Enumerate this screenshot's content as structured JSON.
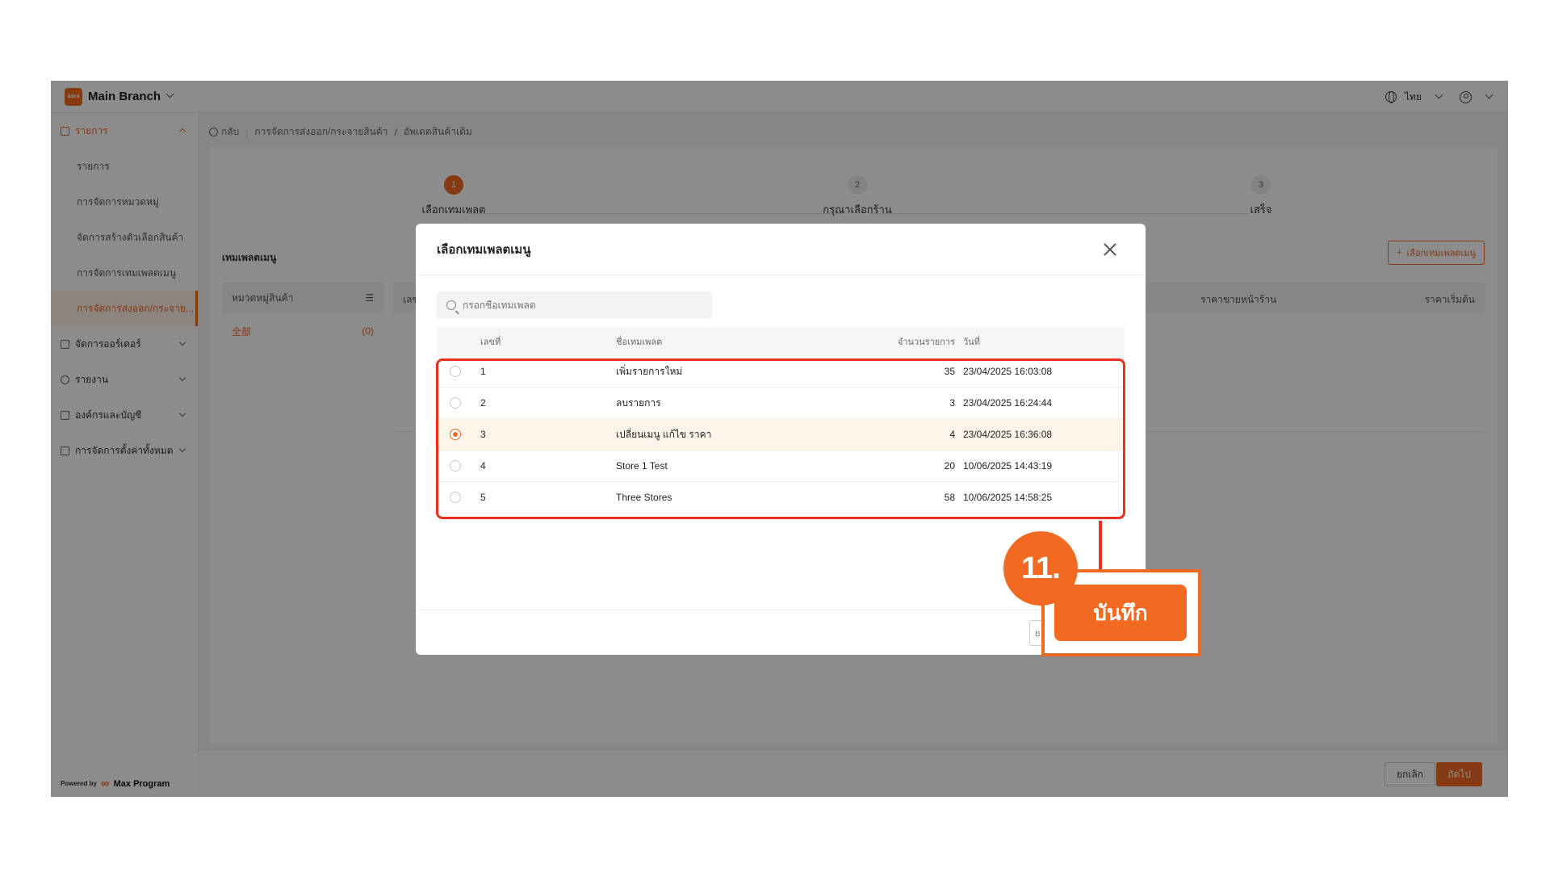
{
  "topbar": {
    "logo_text": "ออเจ",
    "branch": "Main Branch",
    "language": "ไทย"
  },
  "sidebar": {
    "groups": [
      {
        "label": "รายการ",
        "expanded": true,
        "items": [
          "รายการ",
          "การจัดการหมวดหมู่",
          "จัดการสร้างตัวเลือกสินค้า",
          "การจัดการเทมเพลตเมนู",
          "การจัดการส่งออก/กระจาย..."
        ]
      },
      {
        "label": "จัดการออร์เดอร์"
      },
      {
        "label": "รายงาน"
      },
      {
        "label": "องค์กรและบัญชี"
      },
      {
        "label": "การจัดการตั้งค่าทั้งหมด"
      }
    ],
    "powered_by": "Powered by",
    "brand": "Max Program"
  },
  "breadcrumb": {
    "back": "กลับ",
    "path1": "การจัดการส่งออก/กระจายสินค้า",
    "sep": "/",
    "path2": "อัพเดตสินค้าเดิม"
  },
  "steps": [
    {
      "num": "1",
      "label": "เลือกเทมเพลต"
    },
    {
      "num": "2",
      "label": "กรุณาเลือกร้าน"
    },
    {
      "num": "3",
      "label": "เสร็จ"
    }
  ],
  "main": {
    "section_title": "เทมเพลตเมนู",
    "add_template": "เลือกเทมเพลตเมนู",
    "left_header": "หมวดหมู่สินค้า",
    "left_row_label": "全部",
    "left_row_count": "(0)",
    "col_no": "เลข",
    "col_store_price": "ราคาขายหน้าร้าน",
    "col_base_price": "ราคาเริ่มต้น"
  },
  "footer": {
    "cancel": "ยกเลิก",
    "next": "ถัดไป"
  },
  "modal": {
    "title": "เลือกเทมเพลตเมนู",
    "search_placeholder": "กรอกชื่อเทมเพลต",
    "columns": {
      "no": "เลขที่",
      "name": "ชื่อเทมเพลต",
      "qty": "จำนวนรายการ",
      "date": "วันที่"
    },
    "rows": [
      {
        "no": "1",
        "name": "เพิ่มรายการใหม่",
        "qty": "35",
        "date": "23/04/2025 16:03:08",
        "selected": false
      },
      {
        "no": "2",
        "name": "ลบรายการ",
        "qty": "3",
        "date": "23/04/2025 16:24:44",
        "selected": false
      },
      {
        "no": "3",
        "name": "เปลี่ยนเมนู แก้ไข ราคา",
        "qty": "4",
        "date": "23/04/2025 16:36:08",
        "selected": true
      },
      {
        "no": "4",
        "name": "Store 1 Test",
        "qty": "20",
        "date": "10/06/2025 14:43:19",
        "selected": false
      },
      {
        "no": "5",
        "name": "Three Stores",
        "qty": "58",
        "date": "10/06/2025 14:58:25",
        "selected": false
      }
    ],
    "cancel_partial": "ย"
  },
  "annotation": {
    "step_number": "11.",
    "save_label": "บันทึก"
  },
  "colors": {
    "accent": "#f26a21",
    "highlight": "#e8301d"
  }
}
